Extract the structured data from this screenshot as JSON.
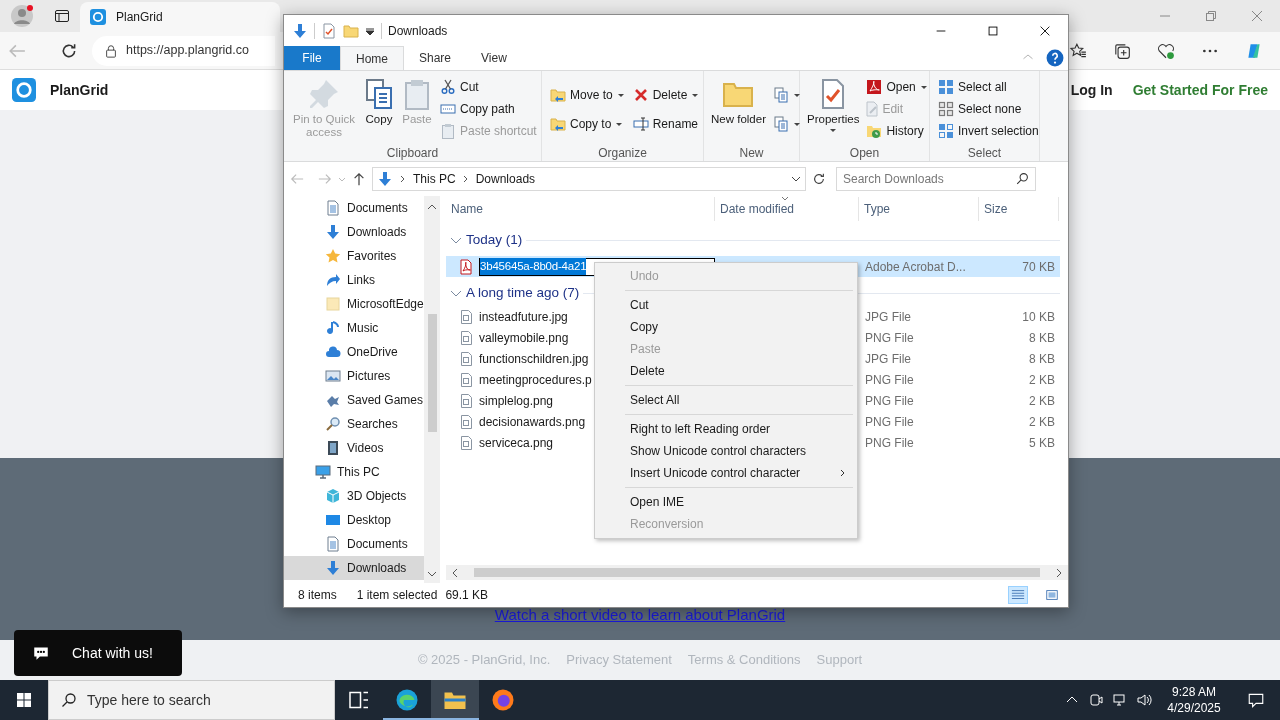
{
  "browser": {
    "tab": {
      "title": "PlanGrid"
    },
    "address": "https://app.plangrid.co"
  },
  "site": {
    "brand": "PlanGrid",
    "nav": [
      {
        "label": "Log In",
        "kind": "login"
      },
      {
        "label": "Get Started For Free",
        "kind": "cta"
      }
    ],
    "video_link": "Watch a short video to learn about PlanGrid",
    "footer": [
      "© 2025 - PlanGrid, Inc.",
      "Privacy Statement",
      "Terms & Conditions",
      "Support"
    ],
    "chat": "Chat with us!"
  },
  "explorer": {
    "title": "Downloads",
    "ribbon_tabs": [
      {
        "label": "File",
        "kind": "menu",
        "selected": false
      },
      {
        "label": "Home",
        "kind": "tab",
        "selected": true
      },
      {
        "label": "Share",
        "kind": "tab",
        "selected": false
      },
      {
        "label": "View",
        "kind": "tab",
        "selected": false
      }
    ],
    "ribbon_groups": [
      {
        "label": "Clipboard",
        "columns": [
          {
            "kind": "large",
            "items": [
              {
                "label": "Pin to Quick access",
                "disabled": true
              }
            ]
          },
          {
            "kind": "large",
            "items": [
              {
                "label": "Copy",
                "disabled": false
              }
            ]
          },
          {
            "kind": "large",
            "items": [
              {
                "label": "Paste",
                "disabled": true
              }
            ]
          },
          {
            "kind": "small",
            "items": [
              {
                "label": "Cut",
                "disabled": false
              },
              {
                "label": "Copy path",
                "disabled": false
              },
              {
                "label": "Paste shortcut",
                "disabled": true
              }
            ]
          }
        ]
      },
      {
        "label": "Organize",
        "columns": [
          {
            "kind": "small",
            "items": [
              {
                "label": "Move to",
                "disabled": false,
                "dropdown": true
              },
              {
                "label": "Copy to",
                "disabled": false,
                "dropdown": true
              }
            ]
          },
          {
            "kind": "small",
            "items": [
              {
                "label": "Delete",
                "disabled": false,
                "dropdown": true
              },
              {
                "label": "Rename",
                "disabled": false
              }
            ]
          }
        ]
      },
      {
        "label": "New",
        "columns": [
          {
            "kind": "large",
            "items": [
              {
                "label": "New folder",
                "disabled": false
              }
            ]
          },
          {
            "kind": "small",
            "items": [
              {
                "disabled": false,
                "dropdown": true
              },
              {
                "disabled": false,
                "dropdown": true
              }
            ]
          }
        ]
      },
      {
        "label": "Open",
        "columns": [
          {
            "kind": "large",
            "items": [
              {
                "label": "Properties",
                "disabled": false,
                "dropdown": true
              }
            ]
          },
          {
            "kind": "small",
            "items": [
              {
                "label": "Open",
                "disabled": false,
                "dropdown": true
              },
              {
                "label": "Edit",
                "disabled": true
              },
              {
                "label": "History",
                "disabled": false
              }
            ]
          }
        ]
      },
      {
        "label": "Select",
        "columns": [
          {
            "kind": "small",
            "items": [
              {
                "label": "Select all",
                "disabled": false
              },
              {
                "label": "Select none",
                "disabled": false
              },
              {
                "label": "Invert selection",
                "disabled": false
              }
            ]
          }
        ]
      }
    ],
    "breadcrumbs": [
      "This PC",
      "Downloads"
    ],
    "search": {
      "placeholder": "Search Downloads"
    },
    "nav_pane": [
      {
        "label": "Documents",
        "selected": false
      },
      {
        "label": "Downloads",
        "selected": false
      },
      {
        "label": "Favorites",
        "selected": false
      },
      {
        "label": "Links",
        "selected": false
      },
      {
        "label": "MicrosoftEdge",
        "selected": false
      },
      {
        "label": "Music",
        "selected": false
      },
      {
        "label": "OneDrive",
        "selected": false
      },
      {
        "label": "Pictures",
        "selected": false
      },
      {
        "label": "Saved Games",
        "selected": false
      },
      {
        "label": "Searches",
        "selected": false
      },
      {
        "label": "Videos",
        "selected": false
      },
      {
        "label": "This PC",
        "selected": false,
        "children": [
          {
            "label": "3D Objects",
            "selected": false
          },
          {
            "label": "Desktop",
            "selected": false
          },
          {
            "label": "Documents",
            "selected": false
          },
          {
            "label": "Downloads",
            "selected": true
          }
        ]
      }
    ],
    "columns": [
      "Name",
      "Date modified",
      "Type",
      "Size"
    ],
    "groups": [
      {
        "label": "Today (1)",
        "files": [
          {
            "name": "3b45645a-8b0d-4a21",
            "kind": "pdf",
            "type": "Adobe Acrobat D...",
            "size": "70 KB",
            "selected": true,
            "editing": true
          }
        ]
      },
      {
        "label": "A long time ago (7)",
        "files": [
          {
            "name": "insteadfuture.jpg",
            "kind": "image",
            "type": "JPG File",
            "size": "10 KB",
            "selected": false,
            "editing": false
          },
          {
            "name": "valleymobile.png",
            "kind": "image",
            "type": "PNG File",
            "size": "8 KB",
            "selected": false,
            "editing": false
          },
          {
            "name": "functionschildren.jpg",
            "kind": "image",
            "type": "JPG File",
            "size": "8 KB",
            "selected": false,
            "editing": false
          },
          {
            "name": "meetingprocedures.p",
            "kind": "image",
            "type": "PNG File",
            "size": "2 KB",
            "selected": false,
            "editing": false
          },
          {
            "name": "simplelog.png",
            "kind": "image",
            "type": "PNG File",
            "size": "2 KB",
            "selected": false,
            "editing": false
          },
          {
            "name": "decisionawards.png",
            "kind": "image",
            "type": "PNG File",
            "size": "2 KB",
            "selected": false,
            "editing": false
          },
          {
            "name": "serviceca.png",
            "kind": "image",
            "type": "PNG File",
            "size": "5 KB",
            "selected": false,
            "editing": false
          }
        ]
      }
    ],
    "status": {
      "count": "8 items",
      "selection": "1 item selected",
      "selection_size": "69.1 KB"
    },
    "views": [
      {
        "selected": true
      },
      {
        "selected": false
      }
    ]
  },
  "context_menu": [
    {
      "kind": "item",
      "label": "Undo",
      "disabled": true
    },
    {
      "kind": "separator"
    },
    {
      "kind": "item",
      "label": "Cut",
      "disabled": false
    },
    {
      "kind": "item",
      "label": "Copy",
      "disabled": false
    },
    {
      "kind": "item",
      "label": "Paste",
      "disabled": true
    },
    {
      "kind": "item",
      "label": "Delete",
      "disabled": false
    },
    {
      "kind": "separator"
    },
    {
      "kind": "item",
      "label": "Select All",
      "disabled": false
    },
    {
      "kind": "separator"
    },
    {
      "kind": "item",
      "label": "Right to left Reading order",
      "disabled": false
    },
    {
      "kind": "item",
      "label": "Show Unicode control characters",
      "disabled": false
    },
    {
      "kind": "item",
      "label": "Insert Unicode control character",
      "disabled": false,
      "submenu": true
    },
    {
      "kind": "separator"
    },
    {
      "kind": "item",
      "label": "Open IME",
      "disabled": false
    },
    {
      "kind": "item",
      "label": "Reconversion",
      "disabled": true
    }
  ],
  "taskbar": {
    "search": {
      "placeholder": "Type here to search"
    },
    "apps": [
      {
        "running": false,
        "active": false
      },
      {
        "running": true,
        "active": false
      },
      {
        "running": true,
        "active": true
      },
      {
        "running": false,
        "active": false
      }
    ],
    "time": "9:28 AM",
    "date": "4/29/2025"
  }
}
